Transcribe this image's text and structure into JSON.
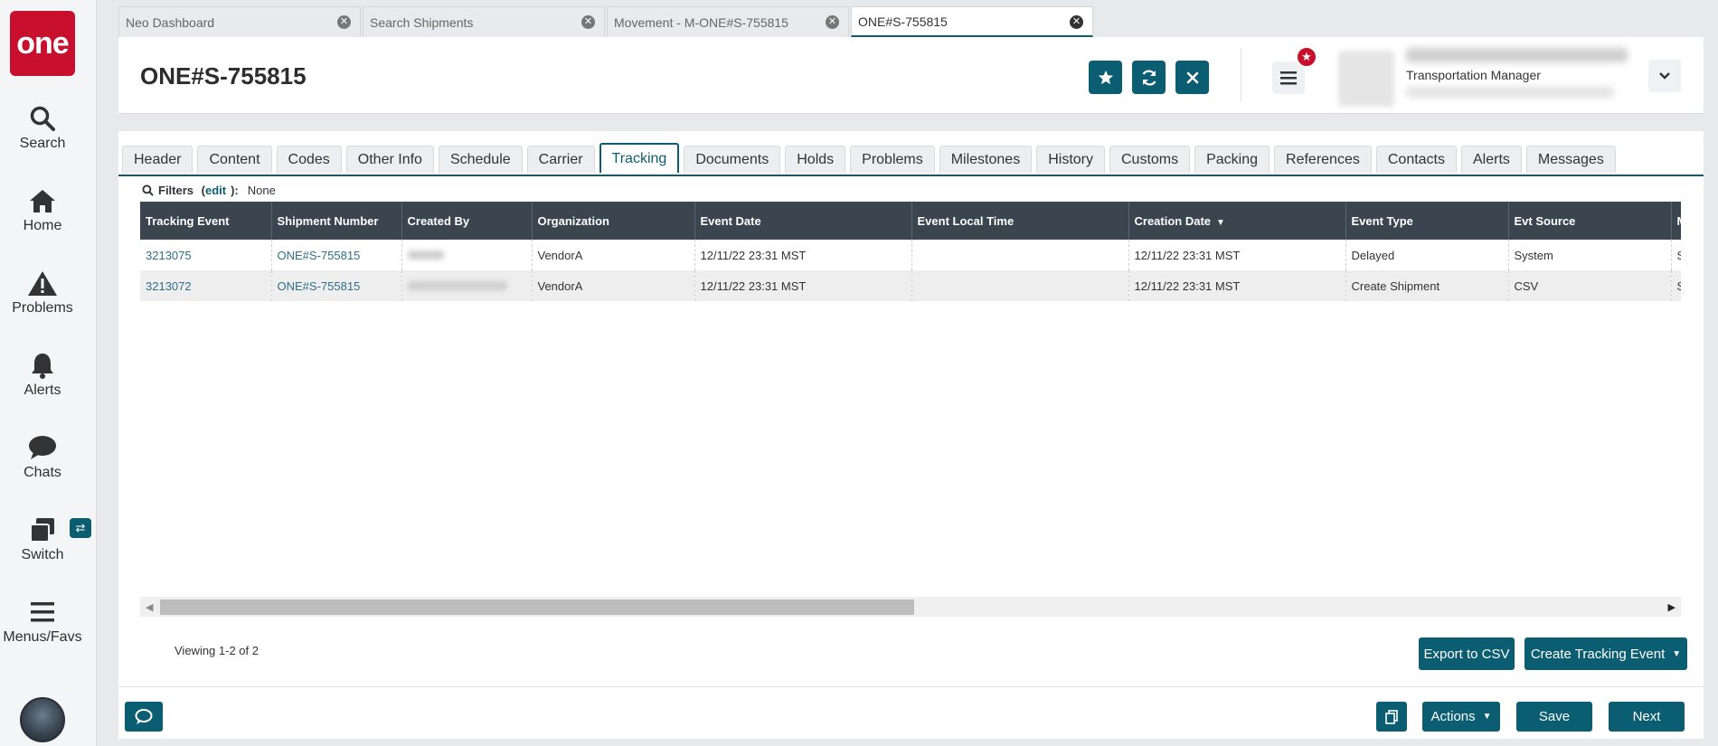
{
  "sidebar": {
    "logo_text": "one",
    "items": [
      {
        "label": "Search",
        "icon": "search-icon"
      },
      {
        "label": "Home",
        "icon": "home-icon"
      },
      {
        "label": "Problems",
        "icon": "warning-icon"
      },
      {
        "label": "Alerts",
        "icon": "bell-icon"
      },
      {
        "label": "Chats",
        "icon": "chat-icon"
      },
      {
        "label": "Switch",
        "icon": "switch-icon"
      },
      {
        "label": "Menus/Favs",
        "icon": "menu-icon"
      }
    ]
  },
  "browser_tabs": [
    {
      "label": "Neo Dashboard"
    },
    {
      "label": "Search Shipments"
    },
    {
      "label": "Movement - M-ONE#S-755815"
    },
    {
      "label": "ONE#S-755815"
    }
  ],
  "header": {
    "title": "ONE#S-755815",
    "user_role": "Transportation Manager"
  },
  "content_tabs": [
    "Header",
    "Content",
    "Codes",
    "Other Info",
    "Schedule",
    "Carrier",
    "Tracking",
    "Documents",
    "Holds",
    "Problems",
    "Milestones",
    "History",
    "Customs",
    "Packing",
    "References",
    "Contacts",
    "Alerts",
    "Messages"
  ],
  "active_tab": "Tracking",
  "filters": {
    "label": "Filters",
    "edit": "edit",
    "value": "None"
  },
  "table": {
    "columns": [
      "Tracking Event",
      "Shipment Number",
      "Created By",
      "Organization",
      "Event Date",
      "Event Local Time",
      "Creation Date",
      "Event Type",
      "Evt Source",
      "M"
    ],
    "rows": [
      {
        "tracking_event": "3213075",
        "shipment_number": "ONE#S-755815",
        "organization": "VendorA",
        "event_date": "12/11/22 23:31 MST",
        "event_local_time": "",
        "creation_date": "12/11/22 23:31 MST",
        "event_type": "Delayed",
        "evt_source": "System",
        "m": "S"
      },
      {
        "tracking_event": "3213072",
        "shipment_number": "ONE#S-755815",
        "organization": "VendorA",
        "event_date": "12/11/22 23:31 MST",
        "event_local_time": "",
        "creation_date": "12/11/22 23:31 MST",
        "event_type": "Create Shipment",
        "evt_source": "CSV",
        "m": "S"
      }
    ]
  },
  "viewing": "Viewing 1-2 of 2",
  "buttons": {
    "export_csv": "Export to CSV",
    "create_tracking": "Create Tracking Event",
    "actions": "Actions",
    "save": "Save",
    "next": "Next"
  },
  "colors": {
    "brand_red": "#c8102e",
    "accent_teal": "#0b5d72",
    "table_header": "#3a4550"
  }
}
